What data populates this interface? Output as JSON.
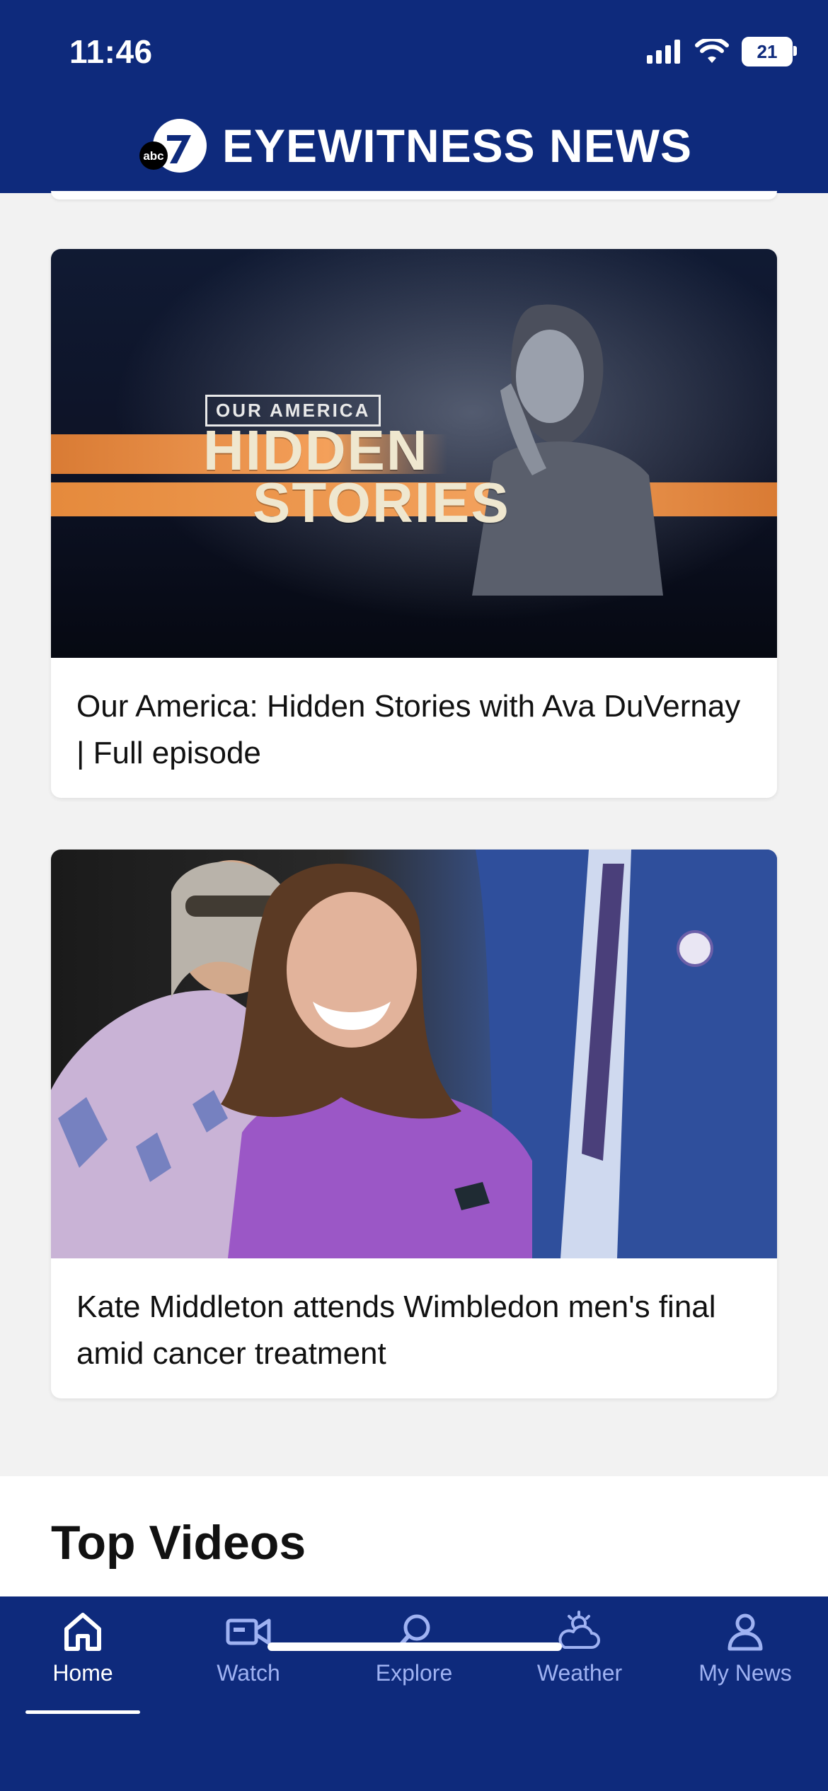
{
  "status": {
    "time": "11:46",
    "battery": "21"
  },
  "header": {
    "title": "EYEWITNESS NEWS",
    "logo_text": "abc",
    "logo_num": "7"
  },
  "cards": [
    {
      "caption": "Our America: Hidden Stories with Ava DuVernay | Full episode",
      "image": {
        "badge": "OUR AMERICA",
        "title_line1": "HIDDEN",
        "title_line2": "STORIES"
      }
    },
    {
      "caption": "Kate Middleton attends Wimbledon men's final amid cancer treatment"
    }
  ],
  "section": {
    "title": "Top Videos"
  },
  "nav": {
    "tabs": [
      {
        "label": "Home",
        "icon": "home-icon",
        "active": true
      },
      {
        "label": "Watch",
        "icon": "video-camera-icon"
      },
      {
        "label": "Explore",
        "icon": "search-icon"
      },
      {
        "label": "Weather",
        "icon": "weather-icon"
      },
      {
        "label": "My News",
        "icon": "person-icon"
      }
    ]
  },
  "colors": {
    "header_bg": "#0e2a7c",
    "nav_inactive": "#9fb2f2",
    "nav_active": "#ffffff"
  }
}
